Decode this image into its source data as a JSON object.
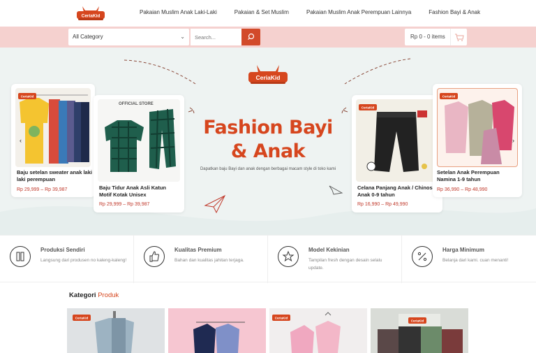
{
  "brand": {
    "name": "CeriaKid",
    "color": "#d6461e"
  },
  "nav": {
    "items": [
      "Pakaian Muslim Anak Laki-Laki",
      "Pakaian & Set Muslim",
      "Pakaian Muslim Anak Perempuan Lainnya",
      "Fashion Bayi & Anak"
    ]
  },
  "search": {
    "category": "All Category",
    "placeholder": "Search..."
  },
  "cart": {
    "label": "Rp 0 - 0 items"
  },
  "hero": {
    "title_line1": "Fashion Bayi",
    "title_line2": "& Anak",
    "subtitle": "Dapatkan baju Bayi dan anak dengan berbagai macam style di toko kami"
  },
  "products": [
    {
      "name": "Baju setelan sweater anak laki laki perempuan",
      "price": "Rp 29,999 – Rp 39,987"
    },
    {
      "name": "Baju Tidur Anak Asli Katun Motif Kotak Unisex",
      "price": "Rp 29,999 – Rp 39,987",
      "stamp": "OFFICIAL STORE"
    },
    {
      "name": "Celana Panjang Anak / Chinos Anak 0-9 tahun",
      "price": "Rp 16,990 – Rp 49,990"
    },
    {
      "name": "Setelan Anak Perempuan Namina 1-9 tahun",
      "price": "Rp 36,990 – Rp 48,990"
    }
  ],
  "features": [
    {
      "title": "Produksi Sendiri",
      "desc": "Langsung dari produsen no kaleng-kaleng!",
      "icon": "factory-icon"
    },
    {
      "title": "Kualitas Premium",
      "desc": "Bahan dan kualitas jahitan terjaga.",
      "icon": "thumbs-up-icon"
    },
    {
      "title": "Model Kekinian",
      "desc": "Tampilan fresh dengan desain selalu update.",
      "icon": "star-icon"
    },
    {
      "title": "Harga Minimum",
      "desc": "Belanja dari kami. cuan menanti!",
      "icon": "percent-icon"
    }
  ],
  "kategori": {
    "title": "Kategori",
    "title_accent": "Produk"
  },
  "colors": {
    "accent": "#d6461e",
    "searchbar": "#f5d1cf",
    "hero_bg": "#eef3f2",
    "price": "#c0392b"
  }
}
